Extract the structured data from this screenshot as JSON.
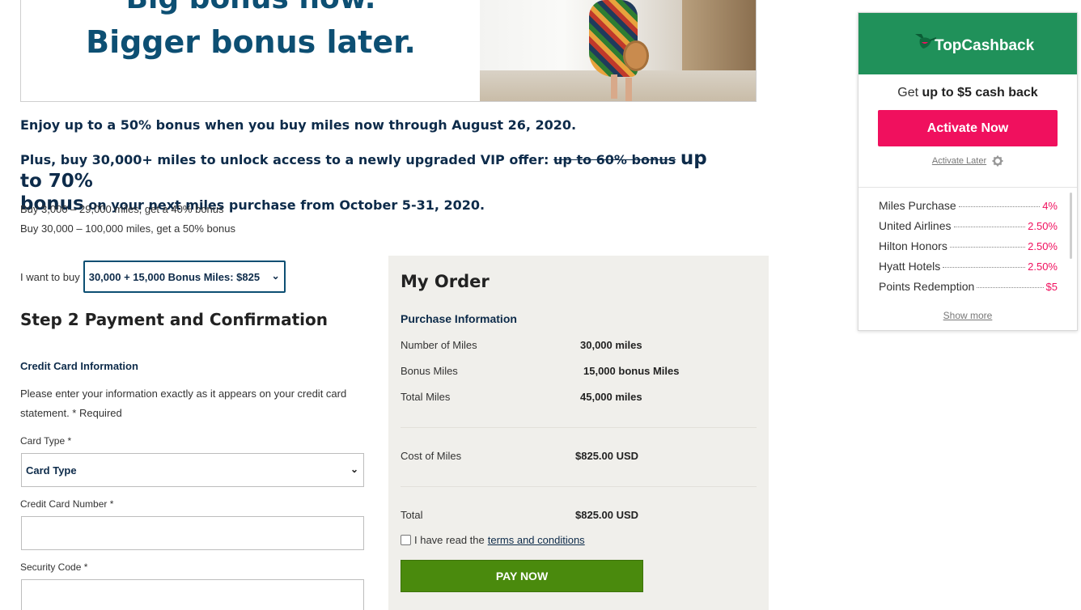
{
  "hero": {
    "line1": "Big bonus now.",
    "line2": "Bigger bonus later."
  },
  "promo": {
    "line1": "Enjoy up to a 50% bonus when you buy miles now through August 26, 2020.",
    "line2_pre": "Plus, buy 30,000+ miles to unlock access to a newly upgraded VIP offer:",
    "line2_strike": "up to 60% bonus",
    "line2_big1": "up to 70%",
    "line2_big2": "bonus",
    "line2_post": "on your next miles purchase from October 5-31, 2020.",
    "tier1": "Buy 3,000 – 29,000 miles, get a 40% bonus",
    "tier2": "Buy 30,000 – 100,000 miles, get a 50% bonus"
  },
  "purchase": {
    "label": "I want to buy",
    "selected": "30,000 + 15,000 Bonus Miles: $825"
  },
  "step2": {
    "title": "Step 2 Payment and Confirmation",
    "cc_title": "Credit Card Information",
    "cc_desc": "Please enter your information exactly as it appears on your credit card statement. * Required",
    "card_type_label": "Card Type *",
    "card_type_value": "Card Type",
    "card_number_label": "Credit Card Number *",
    "security_code_label": "Security Code *"
  },
  "order": {
    "title": "My Order",
    "purchase_info": "Purchase Information",
    "rows": [
      {
        "label": "Number of Miles",
        "value": "30,000 miles"
      },
      {
        "label": "Bonus Miles",
        "value": "15,000 bonus Miles"
      },
      {
        "label": "Total Miles",
        "value": "45,000 miles"
      }
    ],
    "cost_label": "Cost of Miles",
    "cost_value": "$825.00 USD",
    "total_label": "Total",
    "total_value": "$825.00 USD",
    "terms_pre": "I have read the",
    "terms_link": "terms and conditions",
    "pay_label": "PAY NOW"
  },
  "topcashback": {
    "brand": "TopCashback",
    "get_pre": "Get",
    "get_bold": "up to $5 cash back",
    "activate_now": "Activate Now",
    "activate_later": "Activate Later",
    "rates": [
      {
        "name": "Miles Purchase",
        "value": "4%"
      },
      {
        "name": "United Airlines",
        "value": "2.50%"
      },
      {
        "name": "Hilton Honors",
        "value": "2.50%"
      },
      {
        "name": "Hyatt Hotels",
        "value": "2.50%"
      },
      {
        "name": "Points Redemption",
        "value": "$5"
      }
    ],
    "show_more": "Show more",
    "colors": {
      "header": "#20915a",
      "accent": "#f0105e"
    }
  },
  "colors": {
    "navy": "#0d2b4a",
    "pay_button": "#4a8a0d",
    "order_bg": "#f0efeb"
  }
}
